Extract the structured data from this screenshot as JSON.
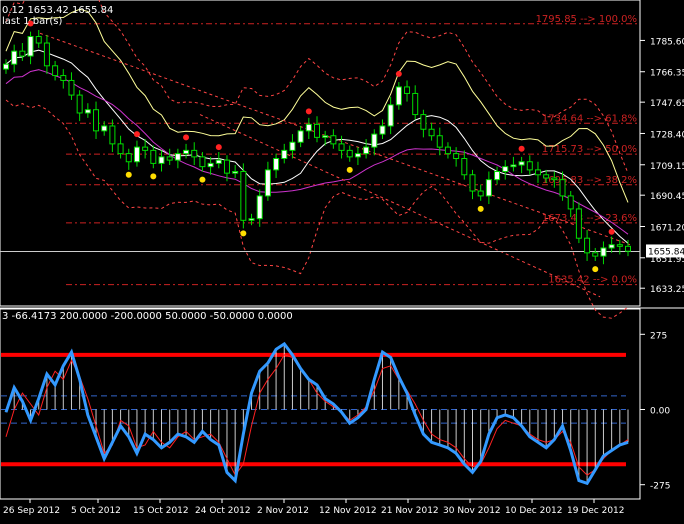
{
  "window": {
    "header_line1": "0.12 1653.42 1655.84",
    "header_line2": "last 1 bar(s)"
  },
  "price_panel": {
    "current_price_label": "1655.84",
    "y_ticks": [
      "1785.60",
      "1766.35",
      "1747.65",
      "1728.40",
      "1709.15",
      "1690.45",
      "1671.20",
      "1651.95",
      "1633.25"
    ],
    "fib_labels": [
      {
        "text": "1795.85 --> 100.0%",
        "price": 1795.85
      },
      {
        "text": "1734.64 --> 61.8%",
        "price": 1734.64
      },
      {
        "text": "1715.73 --> 50.0%",
        "price": 1715.73
      },
      {
        "text": "1696.83 --> 38.2%",
        "price": 1696.83
      },
      {
        "text": "1673.43 --> 23.6%",
        "price": 1673.43
      },
      {
        "text": "1635.42 --> 0.0%",
        "price": 1635.42
      }
    ]
  },
  "indicator_panel": {
    "header": "3 -66.4173 200.0000 -200.0000 50.0000 -50.0000 0.0000",
    "y_ticks": [
      "275",
      "0.00",
      "-275"
    ]
  },
  "x_axis": {
    "labels": [
      "26 Sep 2012",
      "5 Oct 2012",
      "15 Oct 2012",
      "24 Oct 2012",
      "2 Nov 2012",
      "12 Nov 2012",
      "21 Nov 2012",
      "30 Nov 2012",
      "10 Dec 2012",
      "19 Dec 2012"
    ]
  },
  "colors": {
    "background": "#000000",
    "axis": "#ffffff",
    "candle": "#00dd00",
    "candle_body": "#ffffff",
    "fib": "#cc2222",
    "bollinger_mid": "#ffffff",
    "bollinger_upper": "#ffff99",
    "envelope": "#ff4444",
    "ma_magenta": "#cc33cc",
    "cci_main": "#3399ff",
    "cci_signal": "#ff2222",
    "levels_red": "#ff0000",
    "levels_blue": "#3366cc"
  },
  "chart_data": [
    {
      "type": "candlestick",
      "title": "",
      "ylim": [
        1626,
        1808
      ],
      "x": [
        "26 Sep 2012",
        "5 Oct 2012",
        "15 Oct 2012",
        "24 Oct 2012",
        "2 Nov 2012",
        "12 Nov 2012",
        "21 Nov 2012",
        "30 Nov 2012",
        "10 Dec 2012",
        "19 Dec 2012"
      ],
      "closes": [
        1771,
        1779,
        1776,
        1788,
        1784,
        1770,
        1764,
        1761,
        1752,
        1741,
        1743,
        1730,
        1733,
        1722,
        1716,
        1711,
        1720,
        1718,
        1710,
        1714,
        1712,
        1716,
        1718,
        1714,
        1708,
        1710,
        1712,
        1704,
        1705,
        1675,
        1676,
        1690,
        1706,
        1713,
        1718,
        1723,
        1730,
        1734,
        1726,
        1727,
        1722,
        1718,
        1714,
        1716,
        1720,
        1728,
        1733,
        1746,
        1757,
        1753,
        1740,
        1731,
        1727,
        1720,
        1716,
        1713,
        1703,
        1693,
        1690,
        1700,
        1705,
        1708,
        1709,
        1711,
        1706,
        1703,
        1701,
        1700,
        1690,
        1682,
        1664,
        1655,
        1653,
        1658,
        1660,
        1659,
        1656
      ],
      "fib_levels": [
        1795.85,
        1734.64,
        1715.73,
        1696.83,
        1673.43,
        1635.42
      ],
      "current_price": 1655.84
    },
    {
      "type": "line",
      "title": "",
      "ylim": [
        -320,
        320
      ],
      "levels": [
        275,
        200,
        50,
        0,
        -50,
        -200,
        -275
      ],
      "series": [
        {
          "values": [
            -10,
            80,
            30,
            -40,
            40,
            130,
            90,
            160,
            210,
            110,
            -20,
            -100,
            -180,
            -120,
            -60,
            -100,
            -160,
            -90,
            -110,
            -140,
            -120,
            -90,
            -100,
            -120,
            -80,
            -110,
            -130,
            -230,
            -260,
            -90,
            60,
            140,
            170,
            220,
            240,
            200,
            150,
            110,
            90,
            40,
            20,
            -10,
            -50,
            -30,
            0,
            110,
            210,
            190,
            120,
            60,
            -20,
            -90,
            -120,
            -130,
            -140,
            -160,
            -200,
            -230,
            -190,
            -90,
            -30,
            -20,
            -30,
            -60,
            -100,
            -120,
            -140,
            -110,
            -60,
            -150,
            -260,
            -270,
            -220,
            -170,
            -150,
            -130,
            -120
          ]
        },
        {
          "values": [
            -100,
            0,
            60,
            20,
            -20,
            80,
            140,
            110,
            180,
            120,
            40,
            -60,
            -160,
            -130,
            -40,
            -60,
            -140,
            -130,
            -80,
            -120,
            -140,
            -100,
            -80,
            -110,
            -100,
            -90,
            -120,
            -180,
            -240,
            -200,
            -60,
            60,
            110,
            150,
            200,
            190,
            150,
            110,
            60,
            30,
            10,
            -10,
            -40,
            -20,
            10,
            70,
            150,
            160,
            110,
            70,
            20,
            -40,
            -90,
            -110,
            -120,
            -140,
            -180,
            -210,
            -200,
            -140,
            -70,
            -40,
            -50,
            -60,
            -90,
            -110,
            -120,
            -110,
            -80,
            -120,
            -210,
            -240,
            -220,
            -180,
            -150,
            -130,
            -110
          ]
        }
      ]
    }
  ]
}
